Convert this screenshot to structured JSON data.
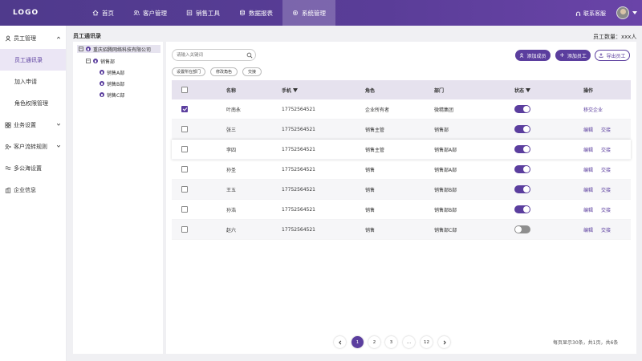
{
  "logo": "LOGO",
  "nav": [
    {
      "label": "首页",
      "icon": "home-icon"
    },
    {
      "label": "客户管理",
      "icon": "customers-icon"
    },
    {
      "label": "销售工具",
      "icon": "tools-icon"
    },
    {
      "label": "数据报表",
      "icon": "database-icon"
    },
    {
      "label": "系统管理",
      "icon": "settings-icon",
      "active": true
    }
  ],
  "header": {
    "support": "联系客服"
  },
  "sidebar": {
    "groups": [
      {
        "label": "员工管理",
        "icon": "user-icon",
        "expanded": true,
        "items": [
          "员工通讯录",
          "加入申请",
          "角色权限管理"
        ],
        "active_item": "员工通讯录"
      },
      {
        "label": "业务设置",
        "icon": "business-icon",
        "expanded": false
      },
      {
        "label": "客户流转规则",
        "icon": "flow-icon",
        "expanded": false
      },
      {
        "label": "多公海设置",
        "icon": "sea-icon",
        "expanded": false
      },
      {
        "label": "企业信息",
        "icon": "company-icon",
        "expanded": false
      }
    ]
  },
  "page": {
    "title": "员工通讯录",
    "employee_count": "员工数量：xxx人"
  },
  "tree": {
    "company": "重庆招腾网络科技有限公司",
    "dept": "销售部",
    "children": [
      "销售A部",
      "销售B部",
      "销售C部"
    ]
  },
  "toolbar": {
    "search_placeholder": "请输入关键词",
    "chips": [
      "设置所在部门",
      "修改角色",
      "交接"
    ],
    "btn_add_member": "添加成员",
    "btn_add_employee": "添加员工",
    "btn_export": "导出员工"
  },
  "table": {
    "headers": {
      "name": "名称",
      "phone": "手机",
      "role": "角色",
      "dept": "部门",
      "status": "状态",
      "ops": "操作"
    },
    "rows": [
      {
        "name": "叶南永",
        "phone": "17752564521",
        "role": "企业所有者",
        "dept": "微精集团",
        "status": true,
        "checked": true,
        "ops": [
          "移交企业"
        ]
      },
      {
        "name": "张三",
        "phone": "17752564521",
        "role": "销售主管",
        "dept": "销售部",
        "status": true,
        "checked": false,
        "ops": [
          "编辑",
          "交接"
        ]
      },
      {
        "name": "李四",
        "phone": "17752564521",
        "role": "销售主管",
        "dept": "销售部A部",
        "status": true,
        "checked": false,
        "ops": [
          "编辑",
          "交接"
        ]
      },
      {
        "name": "孙圣",
        "phone": "17752564521",
        "role": "销售",
        "dept": "销售部A部",
        "status": true,
        "checked": false,
        "ops": [
          "编辑",
          "交接"
        ]
      },
      {
        "name": "王五",
        "phone": "17752564521",
        "role": "销售",
        "dept": "销售部B部",
        "status": true,
        "checked": false,
        "ops": [
          "编辑",
          "交接"
        ]
      },
      {
        "name": "孙浩",
        "phone": "17752564521",
        "role": "销售",
        "dept": "销售部B部",
        "status": true,
        "checked": false,
        "ops": [
          "编辑",
          "交接"
        ]
      },
      {
        "name": "赵六",
        "phone": "17752564521",
        "role": "销售",
        "dept": "销售部C部",
        "status": false,
        "checked": false,
        "ops": [
          "编辑",
          "交接"
        ]
      }
    ]
  },
  "pagination": {
    "pages": [
      "1",
      "2",
      "3",
      "...",
      "12"
    ],
    "current": "1",
    "info": "每页显示30条，共1页，共6条"
  },
  "colors": {
    "primary": "#5b3e9e",
    "header_bg": "#4f3a8c",
    "row_alt": "#f6f6f8"
  }
}
